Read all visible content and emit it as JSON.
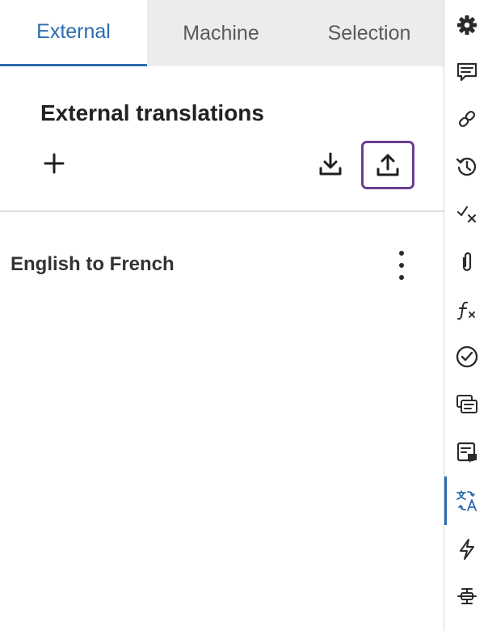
{
  "tabs": [
    {
      "label": "External",
      "active": true
    },
    {
      "label": "Machine",
      "active": false
    },
    {
      "label": "Selection",
      "active": false
    }
  ],
  "section": {
    "title": "External translations"
  },
  "actions": {
    "add_icon": "plus-icon",
    "download_icon": "download-icon",
    "upload_icon": "upload-icon"
  },
  "items": [
    {
      "label": "English to French",
      "menu_icon": "more-vertical-icon"
    }
  ],
  "sidebar": {
    "items": [
      {
        "icon": "gear-icon",
        "active": false
      },
      {
        "icon": "comment-icon",
        "active": false
      },
      {
        "icon": "link-icon",
        "active": false
      },
      {
        "icon": "history-icon",
        "active": false
      },
      {
        "icon": "check-x-icon",
        "active": false
      },
      {
        "icon": "paperclip-icon",
        "active": false
      },
      {
        "icon": "function-icon",
        "active": false
      },
      {
        "icon": "check-circle-icon",
        "active": false
      },
      {
        "icon": "documents-icon",
        "active": false
      },
      {
        "icon": "notes-icon",
        "active": false
      },
      {
        "icon": "translate-icon",
        "active": true
      },
      {
        "icon": "lightning-icon",
        "active": false
      },
      {
        "icon": "split-icon",
        "active": false
      }
    ]
  },
  "colors": {
    "accent": "#2b6cb0",
    "highlight_border": "#6b3e91",
    "tab_bar": "#ececec",
    "icon": "#2a2a2a"
  }
}
